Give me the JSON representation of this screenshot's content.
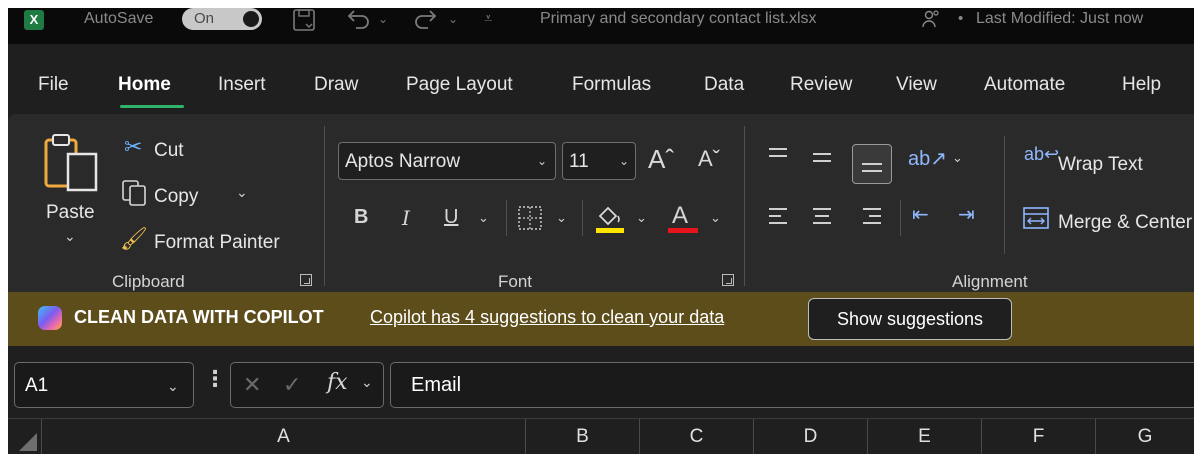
{
  "titlebar": {
    "app_icon": "excel-logo-icon",
    "app_letter": "X",
    "autosave_label": "AutoSave",
    "autosave_state": "On",
    "filename": "Primary and secondary contact list.xlsx",
    "status": "Last Modified: Just now"
  },
  "tabs": [
    "File",
    "Home",
    "Insert",
    "Draw",
    "Page Layout",
    "Formulas",
    "Data",
    "Review",
    "View",
    "Automate",
    "Help"
  ],
  "active_tab": "Home",
  "ribbon": {
    "clipboard": {
      "paste": "Paste",
      "cut": "Cut",
      "copy": "Copy",
      "format_painter": "Format Painter",
      "label": "Clipboard"
    },
    "font": {
      "font_name": "Aptos Narrow",
      "font_size": "11",
      "bold": "B",
      "italic": "I",
      "underline": "U",
      "font_color_glyph": "A",
      "label": "Font",
      "highlight_color": "#ffe400",
      "font_color": "#e8141c"
    },
    "alignment": {
      "wrap_text": "Wrap Text",
      "merge": "Merge & Center",
      "label": "Alignment"
    }
  },
  "copilot": {
    "title": "CLEAN DATA WITH COPILOT",
    "message": "Copilot has 4 suggestions to clean your data",
    "button": "Show suggestions"
  },
  "formula_bar": {
    "name_box": "A1",
    "fx": "fx",
    "value": "Email"
  },
  "columns": [
    "A",
    "B",
    "C",
    "D",
    "E",
    "F",
    "G"
  ],
  "colors": {
    "accent_green": "#2fb36a",
    "copilot_bar": "#5c4d1a"
  }
}
